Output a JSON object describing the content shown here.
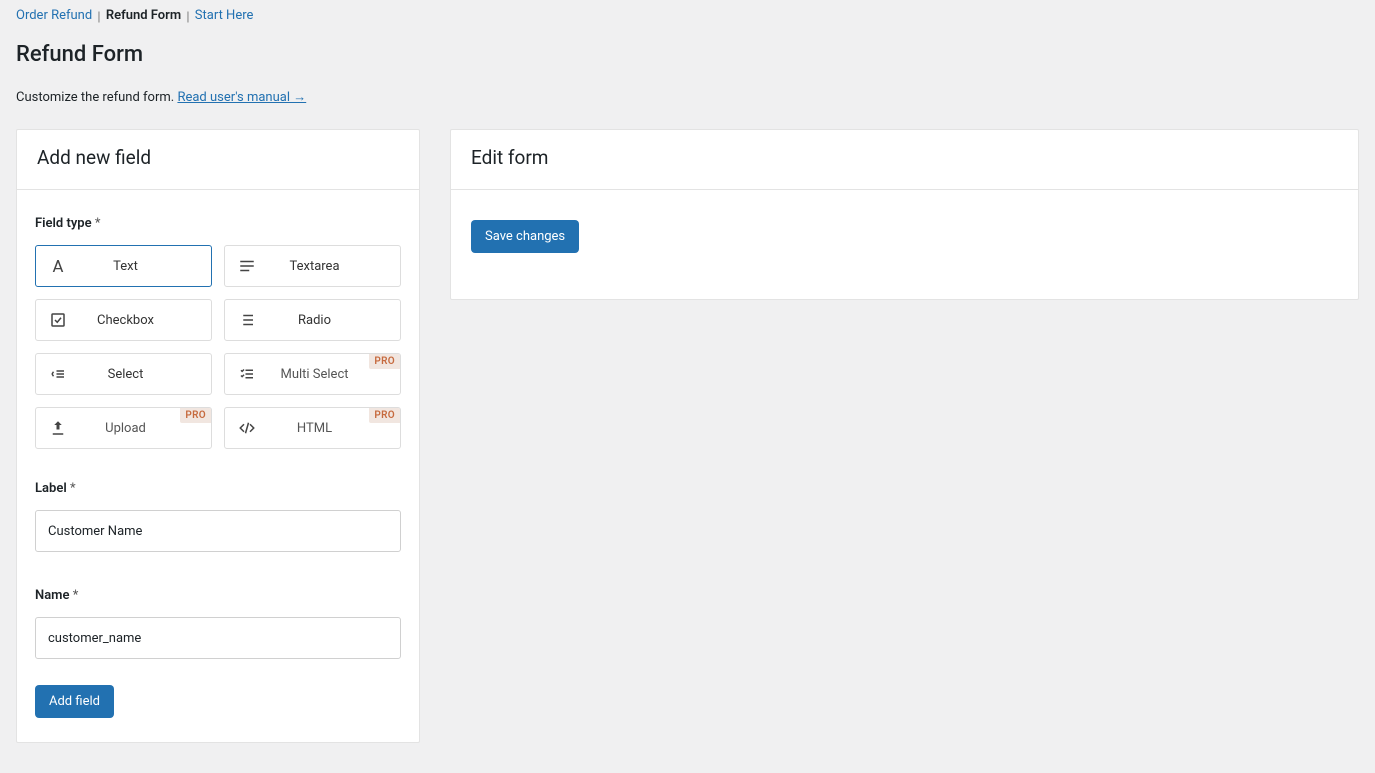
{
  "breadcrumb": {
    "items": [
      {
        "label": "Order Refund",
        "active": false
      },
      {
        "label": "Refund Form",
        "active": true
      },
      {
        "label": "Start Here",
        "active": false
      }
    ],
    "separator": "|"
  },
  "header": {
    "title": "Refund Form",
    "subtitle_prefix": "Customize the refund form. ",
    "manual_link": "Read user's manual →"
  },
  "panels": {
    "add_field": {
      "title": "Add new field",
      "field_type_label": "Field type ",
      "required_mark": "*",
      "tiles": {
        "text": {
          "label": "Text",
          "pro": false,
          "selected": true
        },
        "textarea": {
          "label": "Textarea",
          "pro": false,
          "selected": false
        },
        "checkbox": {
          "label": "Checkbox",
          "pro": false,
          "selected": false
        },
        "radio": {
          "label": "Radio",
          "pro": false,
          "selected": false
        },
        "select": {
          "label": "Select",
          "pro": false,
          "selected": false
        },
        "multiselect": {
          "label": "Multi Select",
          "pro": true,
          "selected": false
        },
        "upload": {
          "label": "Upload",
          "pro": true,
          "selected": false
        },
        "html": {
          "label": "HTML",
          "pro": true,
          "selected": false
        }
      },
      "pro_badge": "PRO",
      "label_label": "Label ",
      "label_value": "Customer Name",
      "name_label": "Name ",
      "name_value": "customer_name",
      "add_button": "Add field"
    },
    "edit_form": {
      "title": "Edit form",
      "save_button": "Save changes"
    }
  }
}
